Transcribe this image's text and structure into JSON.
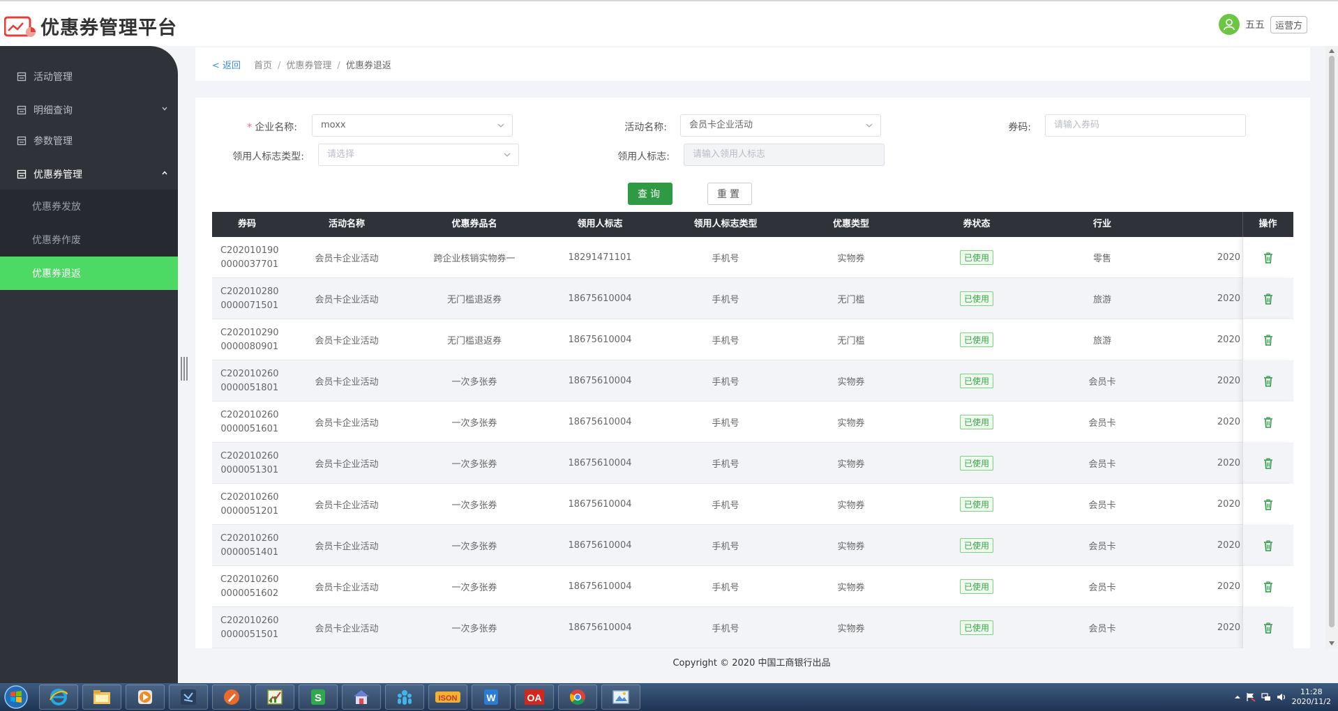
{
  "header": {
    "title": "优惠券管理平台",
    "user_name": "五五",
    "role": "运营方"
  },
  "sidebar": {
    "items": [
      {
        "label": "活动管理"
      },
      {
        "label": "明细查询"
      },
      {
        "label": "参数管理"
      },
      {
        "label": "优惠券管理"
      }
    ],
    "subitems": [
      {
        "label": "优惠券发放"
      },
      {
        "label": "优惠券作废"
      },
      {
        "label": "优惠券退返"
      }
    ]
  },
  "breadcrumb": {
    "back": "< 返回",
    "home": "首页",
    "section": "优惠券管理",
    "current": "优惠券退返"
  },
  "form": {
    "company_label": "企业名称:",
    "company_value": "moxx",
    "activity_label": "活动名称:",
    "activity_value": "会员卡企业活动",
    "code_label": "券码:",
    "code_placeholder": "请输入券码",
    "id_type_label": "领用人标志类型:",
    "id_type_placeholder": "请选择",
    "id_label": "领用人标志:",
    "id_placeholder": "请输入领用人标志",
    "query_button": "查询",
    "reset_button": "重置"
  },
  "table": {
    "headers": [
      "券码",
      "活动名称",
      "优惠券品名",
      "领用人标志",
      "领用人标志类型",
      "优惠类型",
      "券状态",
      "行业"
    ],
    "op_header": "操作",
    "rows": [
      {
        "code1": "C202010190",
        "code2": "0000037701",
        "activity": "会员卡企业活动",
        "name": "跨企业核销实物券一",
        "user_id": "18291471101",
        "id_type": "手机号",
        "type": "实物券",
        "status": "已使用",
        "industry": "零售",
        "date": "2020"
      },
      {
        "code1": "C202010280",
        "code2": "0000071501",
        "activity": "会员卡企业活动",
        "name": "无门槛退返券",
        "user_id": "18675610004",
        "id_type": "手机号",
        "type": "无门槛",
        "status": "已使用",
        "industry": "旅游",
        "date": "2020"
      },
      {
        "code1": "C202010290",
        "code2": "0000080901",
        "activity": "会员卡企业活动",
        "name": "无门槛退返券",
        "user_id": "18675610004",
        "id_type": "手机号",
        "type": "无门槛",
        "status": "已使用",
        "industry": "旅游",
        "date": "2020"
      },
      {
        "code1": "C202010260",
        "code2": "0000051801",
        "activity": "会员卡企业活动",
        "name": "一次多张券",
        "user_id": "18675610004",
        "id_type": "手机号",
        "type": "实物券",
        "status": "已使用",
        "industry": "会员卡",
        "date": "2020"
      },
      {
        "code1": "C202010260",
        "code2": "0000051601",
        "activity": "会员卡企业活动",
        "name": "一次多张券",
        "user_id": "18675610004",
        "id_type": "手机号",
        "type": "实物券",
        "status": "已使用",
        "industry": "会员卡",
        "date": "2020"
      },
      {
        "code1": "C202010260",
        "code2": "0000051301",
        "activity": "会员卡企业活动",
        "name": "一次多张券",
        "user_id": "18675610004",
        "id_type": "手机号",
        "type": "实物券",
        "status": "已使用",
        "industry": "会员卡",
        "date": "2020"
      },
      {
        "code1": "C202010260",
        "code2": "0000051201",
        "activity": "会员卡企业活动",
        "name": "一次多张券",
        "user_id": "18675610004",
        "id_type": "手机号",
        "type": "实物券",
        "status": "已使用",
        "industry": "会员卡",
        "date": "2020"
      },
      {
        "code1": "C202010260",
        "code2": "0000051401",
        "activity": "会员卡企业活动",
        "name": "一次多张券",
        "user_id": "18675610004",
        "id_type": "手机号",
        "type": "实物券",
        "status": "已使用",
        "industry": "会员卡",
        "date": "2020"
      },
      {
        "code1": "C202010260",
        "code2": "0000051602",
        "activity": "会员卡企业活动",
        "name": "一次多张券",
        "user_id": "18675610004",
        "id_type": "手机号",
        "type": "实物券",
        "status": "已使用",
        "industry": "会员卡",
        "date": "2020"
      },
      {
        "code1": "C202010260",
        "code2": "0000051501",
        "activity": "会员卡企业活动",
        "name": "一次多张券",
        "user_id": "18675610004",
        "id_type": "手机号",
        "type": "实物券",
        "status": "已使用",
        "industry": "会员卡",
        "date": "2020"
      }
    ]
  },
  "footer": {
    "copyright": "Copyright © 2020 中国工商银行出品"
  },
  "taskbar": {
    "apps": [
      "ie-icon",
      "explorer-icon",
      "media-player-icon",
      "vscode-icon",
      "pen-tool-icon",
      "chart-app-icon",
      "spreadsheet-icon",
      "home-network-icon",
      "team-icon",
      "json-tool-icon",
      "word-icon",
      "oa-icon",
      "chrome-icon",
      "image-viewer-icon"
    ],
    "ja_label": "ISON",
    "oa_label": "OA",
    "s_label": "S",
    "w_label": "W",
    "time": "11:28",
    "date": "2020/11/2"
  },
  "colors": {
    "accent": "#4cd964",
    "primary_button": "#2e9b44",
    "sidebar_bg": "#2f3238",
    "link": "#3a8ee6"
  }
}
